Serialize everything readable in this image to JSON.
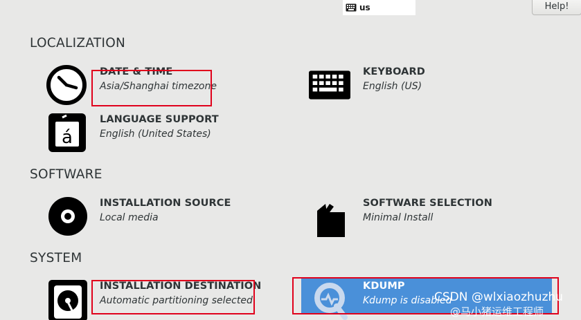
{
  "topbar": {
    "keyboard_layout": "us",
    "help_label": "Help!"
  },
  "sections": {
    "localization": "LOCALIZATION",
    "software": "SOFTWARE",
    "system": "SYSTEM"
  },
  "spokes": {
    "date_time": {
      "name": "DATE & TIME",
      "status": "Asia/Shanghai timezone",
      "icon": "clock-icon"
    },
    "keyboard": {
      "name": "KEYBOARD",
      "status": "English (US)",
      "icon": "keyboard-icon"
    },
    "language": {
      "name": "LANGUAGE SUPPORT",
      "status": "English (United States)",
      "icon": "language-icon"
    },
    "install_source": {
      "name": "INSTALLATION SOURCE",
      "status": "Local media",
      "icon": "disc-icon"
    },
    "software_selection": {
      "name": "SOFTWARE SELECTION",
      "status": "Minimal Install",
      "icon": "package-icon"
    },
    "install_destination": {
      "name": "INSTALLATION DESTINATION",
      "status": "Automatic partitioning selected",
      "icon": "hard-drive-icon"
    },
    "kdump": {
      "name": "KDUMP",
      "status": "Kdump is disabled",
      "icon": "search-icon"
    }
  },
  "colors": {
    "background": "#e8e8e7",
    "selected": "#4a90d9",
    "annotation_box": "#e0001b"
  },
  "watermark": {
    "line1": "CSDN @wlxiaozhuzhu",
    "line2": "@马小猪运维工程师"
  }
}
